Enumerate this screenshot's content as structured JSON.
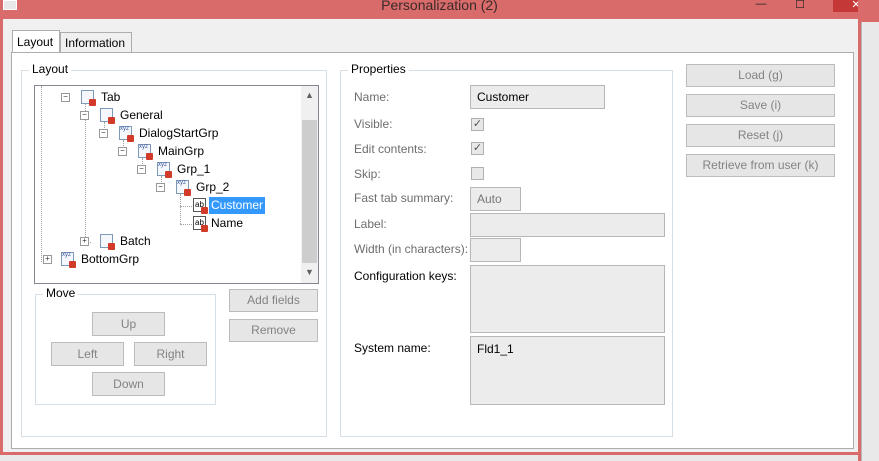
{
  "window": {
    "title": "Personalization (2)",
    "minimize": "—",
    "maximize": "☐",
    "close": "✕"
  },
  "tabs": [
    {
      "label": "Layout"
    },
    {
      "label": "Information"
    }
  ],
  "layout": {
    "legend": "Layout",
    "tree": [
      {
        "label": "Tab"
      },
      {
        "label": "General"
      },
      {
        "label": "DialogStartGrp"
      },
      {
        "label": "MainGrp"
      },
      {
        "label": "Grp_1"
      },
      {
        "label": "Grp_2"
      },
      {
        "label": "Customer"
      },
      {
        "label": "Name"
      },
      {
        "label": "Batch"
      },
      {
        "label": "BottomGrp"
      }
    ],
    "move": {
      "legend": "Move",
      "up": "Up",
      "left": "Left",
      "right": "Right",
      "down": "Down"
    },
    "add_fields": "Add fields",
    "remove": "Remove"
  },
  "properties": {
    "legend": "Properties",
    "name_label": "Name:",
    "name_value": "Customer",
    "visible_label": "Visible:",
    "visible_checked": true,
    "edit_label": "Edit contents:",
    "edit_checked": true,
    "skip_label": "Skip:",
    "skip_checked": false,
    "fasttab_label": "Fast tab summary:",
    "fasttab_value": "Auto",
    "label_label": "Label:",
    "label_value": "",
    "width_label": "Width (in characters):",
    "width_value": "",
    "config_label": "Configuration keys:",
    "config_value": "",
    "sysname_label": "System name:",
    "sysname_value": "Fld1_1"
  },
  "actions": {
    "load": "Load (g)",
    "save": "Save (i)",
    "reset": "Reset (j)",
    "retrieve": "Retrieve from user (k)"
  }
}
